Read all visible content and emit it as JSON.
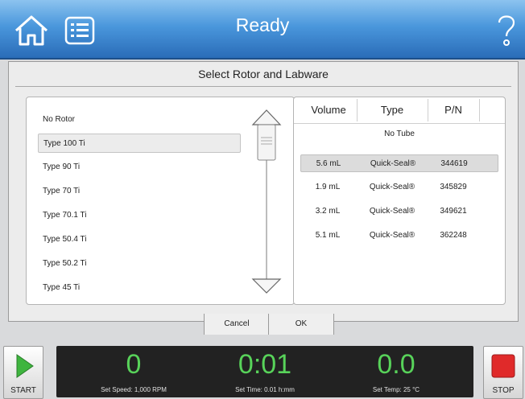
{
  "header": {
    "status": "Ready",
    "home_icon": "home-icon",
    "list_icon": "list-icon",
    "help_icon": "help-icon"
  },
  "dialog": {
    "title": "Select Rotor and Labware",
    "rotors": [
      {
        "label": "No Rotor"
      },
      {
        "label": "Type 100 Ti"
      },
      {
        "label": "Type 90 Ti"
      },
      {
        "label": "Type 70 Ti"
      },
      {
        "label": "Type 70.1 Ti"
      },
      {
        "label": "Type 50.4 Ti"
      },
      {
        "label": "Type 50.2 Ti"
      },
      {
        "label": "Type 45 Ti"
      }
    ],
    "selected_rotor": "Type 100 Ti",
    "tube_columns": {
      "volume": "Volume",
      "type": "Type",
      "pn": "P/N"
    },
    "no_tube": "No Tube",
    "tubes": [
      {
        "volume": "5.6 mL",
        "type": "Quick-Seal®",
        "pn": "344619"
      },
      {
        "volume": "1.9 mL",
        "type": "Quick-Seal®",
        "pn": "345829"
      },
      {
        "volume": "3.2 mL",
        "type": "Quick-Seal®",
        "pn": "349621"
      },
      {
        "volume": "5.1 mL",
        "type": "Quick-Seal®",
        "pn": "362248"
      }
    ],
    "cancel_label": "Cancel",
    "ok_label": "OK"
  },
  "bottom": {
    "start_label": "START",
    "stop_label": "STOP",
    "speed_value": "0",
    "speed_label": "Set Speed: 1,000 RPM",
    "time_value": "0:01",
    "time_label": "Set Time: 0.01 h:mm",
    "temp_value": "0.0",
    "temp_label": "Set Temp: 25 °C"
  },
  "colors": {
    "header": "#4a97dc",
    "readout_text": "#58d35a",
    "stop": "#e02a2a",
    "start": "#3fb53f"
  }
}
